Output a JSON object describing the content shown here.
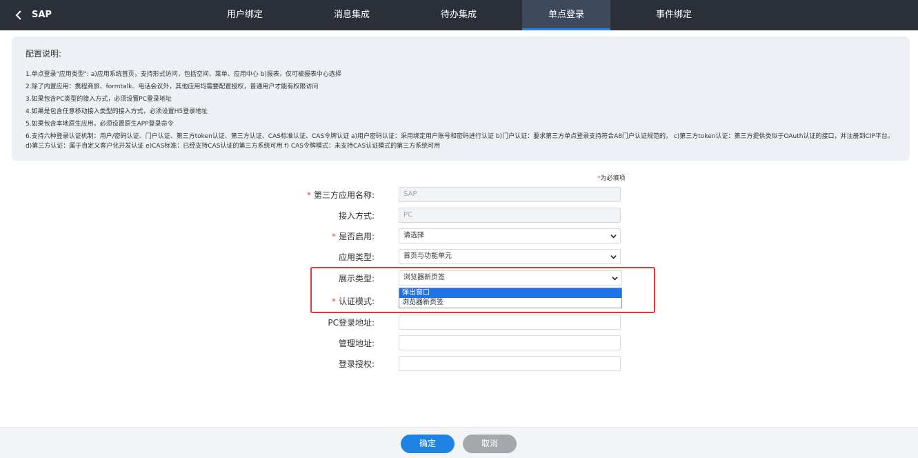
{
  "header": {
    "app_title": "SAP",
    "tabs": [
      {
        "label": "用户绑定"
      },
      {
        "label": "消息集成"
      },
      {
        "label": "待办集成"
      },
      {
        "label": "单点登录"
      },
      {
        "label": "事件绑定"
      }
    ],
    "active_tab": "单点登录"
  },
  "notes": {
    "title": "配置说明:",
    "lines": [
      "1.单点登录\"应用类型\": a)应用系统首页，支持形式访问，包括空间、菜单、应用中心 b)报表，仅可被报表中心选择",
      "2.除了内置应用：携程商旅、formtalk、电话会议外，其他应用均需要配置授权，普通用户才能有权限访问",
      "3.如果包含PC类型的接入方式，必须设置PC登录地址",
      "4.如果是包含任意移动接入类型的接入方式，必须设置H5登录地址",
      "5.如果包含本地原生应用，必须设置原生APP登录命令",
      "6.支持六种登录认证机制：用户/密码认证、门户认证、第三方token认证、第三方认证、CAS标准认证、CAS令牌认证 a)用户密码认证：采用绑定用户账号和密码进行认证 b)门户认证：要求第三方单点登录支持符合A8门户认证规范的。 c)第三方token认证：第三方提供类似于OAuth认证的接口，并注册到CIP平台。 d)第三方认证：属于自定义客户化开发认证 e)CAS标准：已经支持CAS认证的第三方系统可用 f) CAS令牌模式：未支持CAS认证模式的第三方系统可用"
    ]
  },
  "form": {
    "required_hint_star": "*",
    "required_hint": "为必填项",
    "fields": {
      "app_name": {
        "label": "第三方应用名称:",
        "value": "SAP"
      },
      "access_mode": {
        "label": "接入方式:",
        "value": "PC"
      },
      "enabled": {
        "label": "是否启用:",
        "value": "请选择"
      },
      "app_type": {
        "label": "应用类型:",
        "value": "首页与功能单元"
      },
      "display_type": {
        "label": "展示类型:",
        "value": "浏览器新页签",
        "options": [
          "弹出窗口",
          "浏览器新页签"
        ],
        "highlighted_option": "弹出窗口"
      },
      "auth_mode": {
        "label": "认证模式:",
        "value": ""
      },
      "pc_login_url": {
        "label": "PC登录地址:",
        "value": ""
      },
      "admin_url": {
        "label": "管理地址:",
        "value": ""
      },
      "login_auth": {
        "label": "登录授权:",
        "value": ""
      }
    }
  },
  "footer": {
    "confirm_label": "确定",
    "cancel_label": "取消"
  },
  "colors": {
    "topbar": "#2b2f38",
    "active_tab": "#3d4a5c",
    "accent": "#1f83e6",
    "required_star": "#e84b4b",
    "highlight_border": "#e53935",
    "cancel_button": "#a4a7ab"
  }
}
